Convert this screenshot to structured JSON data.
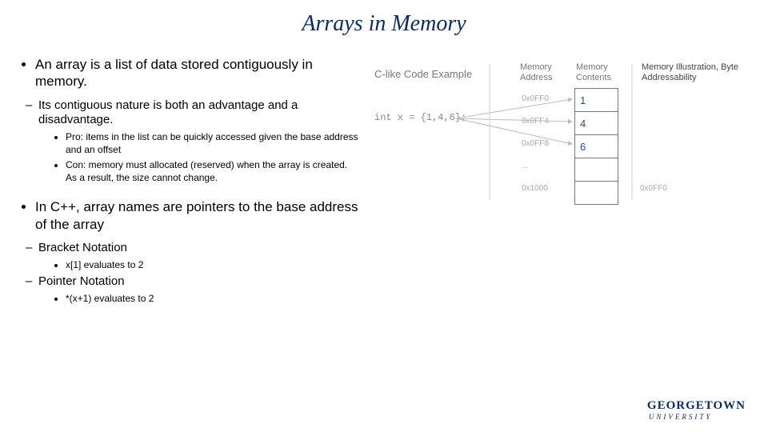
{
  "title": "Arrays in Memory",
  "bullets": {
    "b1a": "An array is a list of data stored contiguously in memory.",
    "b2a": "Its contiguous nature is both an advantage and a disadvantage.",
    "b3a": "Pro: items in the list can be quickly accessed given the base address and an offset",
    "b3b": "Con: memory must allocated (reserved) when the array is created. As a result, the size cannot change.",
    "b1b": "In C++, array names are pointers to the base address of the array",
    "b2b": "Bracket Notation",
    "b3c": "x[1] evaluates to 2",
    "b2c": "Pointer Notation",
    "b3d": "*(x+1) evaluates to 2"
  },
  "diagram": {
    "code_label": "C-like Code Example",
    "code_snippet": "int x = {1,4,6};",
    "addr_label": "Memory Address",
    "cont_label": "Memory Contents",
    "ill_label": "Memory Illustration, Byte Addressability",
    "addresses": [
      "0x0FF0",
      "0x0FF4",
      "0x0FF8",
      "...",
      "0x1000"
    ],
    "contents": [
      "1",
      "4",
      "6",
      "",
      ""
    ],
    "extra_addr": "0x0FF0"
  },
  "footer": {
    "l1": "GEORGETOWN",
    "l2": "UNIVERSITY"
  }
}
